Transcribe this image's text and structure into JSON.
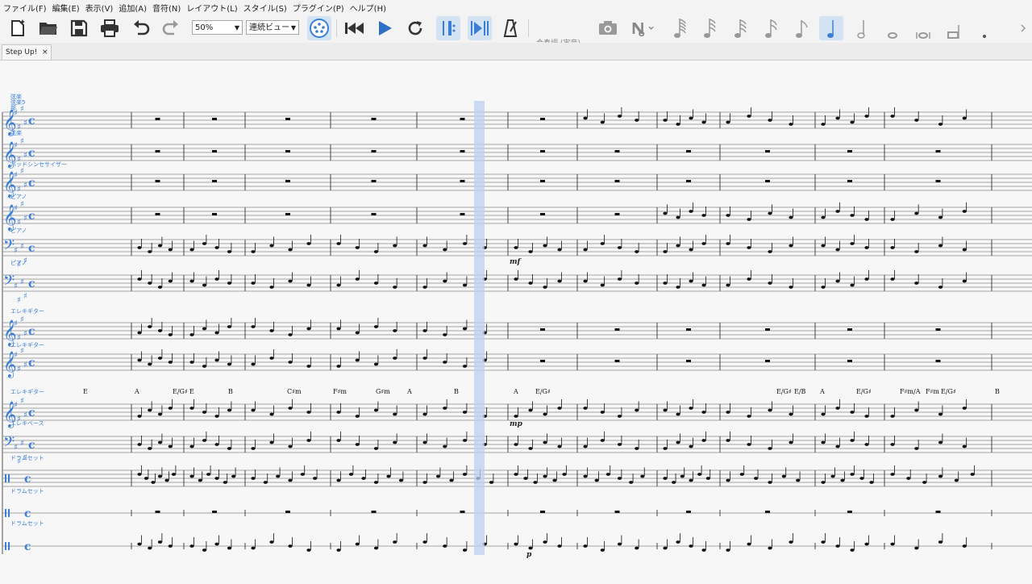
{
  "menu": [
    "ファイル(F)",
    "編集(E)",
    "表示(V)",
    "追加(A)",
    "音符(N)",
    "レイアウト(L)",
    "スタイル(S)",
    "プラグイン(P)",
    "ヘルプ(H)"
  ],
  "toolbar": {
    "zoom": "50%",
    "view_mode": "連続ビュー",
    "concert_pitch": "合奏調 (実音)",
    "icons": [
      "new-score-icon",
      "open-file-icon",
      "save-icon",
      "print-icon",
      "undo-icon",
      "redo-icon",
      "midi-input-icon",
      "rewind-icon",
      "play-icon",
      "loop-icon",
      "loop-in-icon",
      "loop-out-icon",
      "metronome-icon",
      "image-capture-icon",
      "note-input-icon",
      "note-128th-icon",
      "note-64th-icon",
      "note-32nd-icon",
      "note-16th-icon",
      "note-eighth-icon",
      "note-quarter-icon",
      "note-half-icon",
      "note-whole-icon",
      "note-breve-icon",
      "note-longa-icon",
      "augmentation-dot-icon"
    ],
    "active_duration": "note-quarter-icon"
  },
  "tab": {
    "title": "Step Up!",
    "close": "×"
  },
  "score": {
    "instruments": [
      "弦楽\n弦楽5部",
      "弦楽",
      "パッドシンセサイザー",
      "ピアノ",
      "ピアノ",
      "ピアノ",
      "エレキギター",
      "エレキギター",
      "エレキギター",
      "エレキベース",
      "ドラムセット",
      "ドラムセット",
      "ドラムセット"
    ],
    "chords": [
      "E",
      "A",
      "E/G♯",
      "E",
      "B",
      "C♯m",
      "F♯m",
      "G♯m",
      "A",
      "B",
      "A",
      "E/G♯",
      "E/G♯",
      "E/B",
      "A",
      "E/G♯",
      "F♯m/A",
      "F♯m",
      "E/G♯",
      "B"
    ],
    "dynamics": [
      "mf",
      "mp",
      "p"
    ],
    "key": "E major (4 sharps)",
    "time_signature": "C (4/4)",
    "accent": "#3b7ed6",
    "selection_color": "#bcd0f0"
  }
}
